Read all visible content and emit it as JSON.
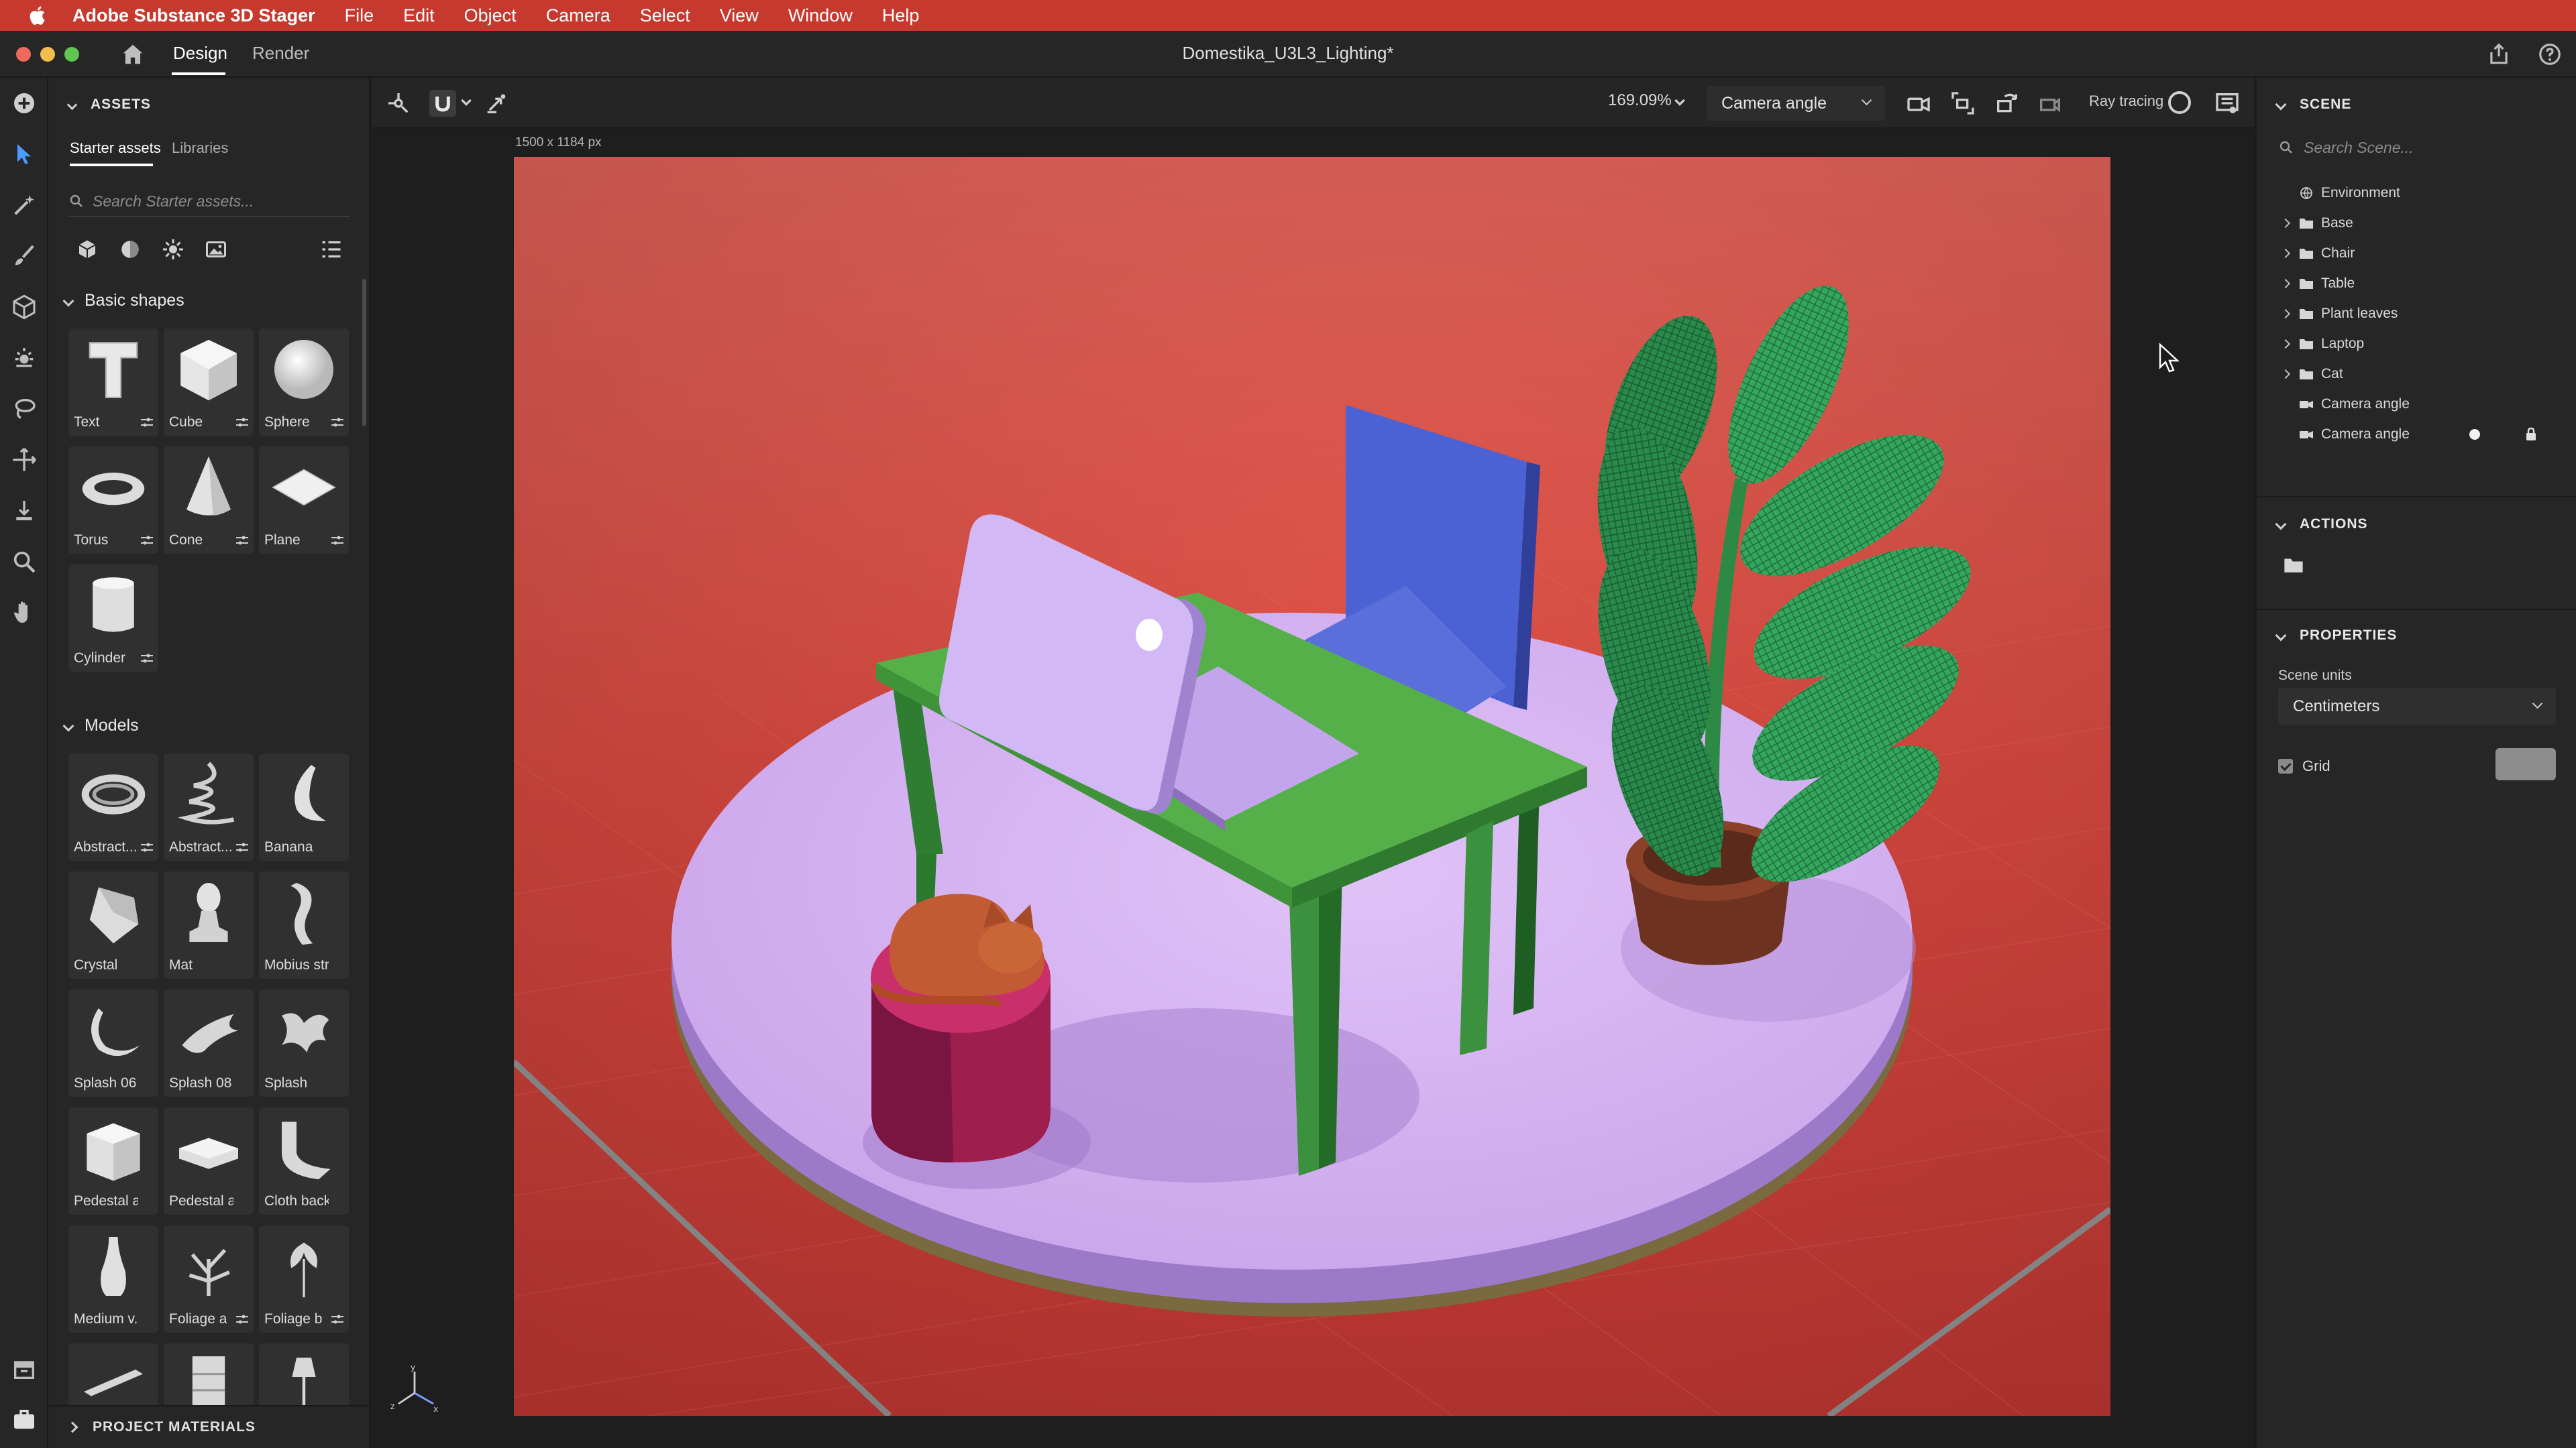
{
  "menubar": {
    "app_name": "Adobe Substance 3D Stager",
    "items": [
      "File",
      "Edit",
      "Object",
      "Camera",
      "Select",
      "View",
      "Window",
      "Help"
    ]
  },
  "titlebar": {
    "tabs": [
      "Design",
      "Render"
    ],
    "document_title": "Domestika_U3L3_Lighting*"
  },
  "assets": {
    "header": "ASSETS",
    "subtabs": [
      "Starter assets",
      "Libraries"
    ],
    "search_placeholder": "Search Starter assets...",
    "basic_shapes_title": "Basic shapes",
    "basic_shapes": [
      "Text",
      "Cube",
      "Sphere",
      "Torus",
      "Cone",
      "Plane",
      "Cylinder"
    ],
    "models_title": "Models",
    "models": [
      "Abstract...",
      "Abstract...",
      "Banana",
      "Crystal",
      "Mat",
      "Mobius strip",
      "Splash 06",
      "Splash 08",
      "Splash",
      "Pedestal a...",
      "Pedestal a...",
      "Cloth back...",
      "Medium v...",
      "Foliage a",
      "Foliage b"
    ],
    "project_materials": "PROJECT MATERIALS"
  },
  "viewport": {
    "zoom": "169.09%",
    "camera_selector": "Camera angle",
    "ray_tracing_label": "Ray tracing",
    "canvas_size": "1500 x 1184 px"
  },
  "scene_panel": {
    "header": "SCENE",
    "search_placeholder": "Search Scene...",
    "items": [
      {
        "label": "Environment",
        "icon": "environment-icon",
        "expandable": false
      },
      {
        "label": "Base",
        "icon": "folder-icon",
        "expandable": true
      },
      {
        "label": "Chair",
        "icon": "folder-icon",
        "expandable": true
      },
      {
        "label": "Table",
        "icon": "folder-icon",
        "expandable": true
      },
      {
        "label": "Plant leaves",
        "icon": "folder-icon",
        "expandable": true
      },
      {
        "label": "Laptop",
        "icon": "folder-icon",
        "expandable": true
      },
      {
        "label": "Cat",
        "icon": "folder-icon",
        "expandable": true
      },
      {
        "label": "Camera angle",
        "icon": "camera-icon",
        "expandable": false
      },
      {
        "label": "Camera angle",
        "icon": "camera-icon",
        "expandable": false
      }
    ]
  },
  "actions_panel": {
    "header": "ACTIONS"
  },
  "properties_panel": {
    "header": "PROPERTIES",
    "scene_units_label": "Scene units",
    "scene_units_value": "Centimeters",
    "grid_label": "Grid",
    "grid_checked": true
  },
  "colors": {
    "menubar": "#c5392f",
    "background": "#d9433a",
    "base_top": "#d7b3f0",
    "table": "#4ea84a",
    "chair": "#4a5fcf",
    "leaves": "#2f9a56",
    "pot": "#7a3a24",
    "cat": "#c05a32",
    "cushion": "#b8245c",
    "brand_badge": "#d81e24"
  }
}
